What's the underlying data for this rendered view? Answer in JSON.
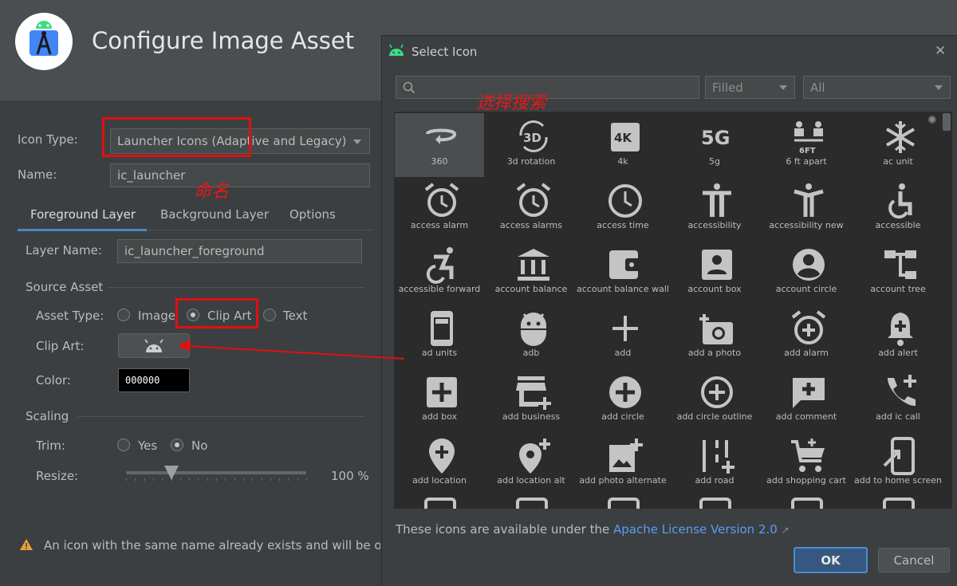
{
  "wizard": {
    "title": "Configure Image Asset",
    "icon_type_label": "Icon Type:",
    "icon_type_value": "Launcher Icons (Adaptive and Legacy)",
    "name_label": "Name:",
    "name_value": "ic_launcher",
    "tabs": [
      "Foreground Layer",
      "Background Layer",
      "Options"
    ],
    "layer_name_label": "Layer Name:",
    "layer_name_value": "ic_launcher_foreground",
    "source_asset_label": "Source Asset",
    "asset_type_label": "Asset Type:",
    "asset_types": [
      "Image",
      "Clip Art",
      "Text"
    ],
    "selected_asset_type": "Clip Art",
    "clip_art_label": "Clip Art:",
    "color_label": "Color:",
    "color_value": "000000",
    "scaling_label": "Scaling",
    "trim_label": "Trim:",
    "trim_options": [
      "Yes",
      "No"
    ],
    "trim_selected": "No",
    "resize_label": "Resize:",
    "resize_value": "100 %",
    "resize_fraction": 0.25,
    "warning_text": "An icon with the same name already exists and will be over"
  },
  "annotations": {
    "name_note": "命名",
    "search_note": "选择搜索"
  },
  "dialog": {
    "title": "Select Icon",
    "search_value": "",
    "style_filter": "Filled",
    "category_filter": "All",
    "license_prefix": "These icons are available under the ",
    "license_link": "Apache License Version 2.0",
    "license_link_suffix": "↗",
    "ok_label": "OK",
    "cancel_label": "Cancel",
    "close_glyph": "✕",
    "icons": [
      "360",
      "3d rotation",
      "4k",
      "5g",
      "6 ft apart",
      "ac unit",
      "access alarm",
      "access alarms",
      "access time",
      "accessibility",
      "accessibility new",
      "accessible",
      "accessible forward",
      "account balance",
      "account balance wall",
      "account box",
      "account circle",
      "account tree",
      "ad units",
      "adb",
      "add",
      "add a photo",
      "add alarm",
      "add alert",
      "add box",
      "add business",
      "add circle",
      "add circle outline",
      "add comment",
      "add ic call",
      "add location",
      "add location alt",
      "add photo alternate",
      "add road",
      "add shopping cart",
      "add to home screen"
    ],
    "selected_icon": "360"
  },
  "colors": {
    "background": "#3c3f41",
    "header": "#4b4e50",
    "link": "#589df6",
    "annotation_red": "#e01010",
    "android_green": "#3ddc84",
    "ok_button": "#365880"
  }
}
